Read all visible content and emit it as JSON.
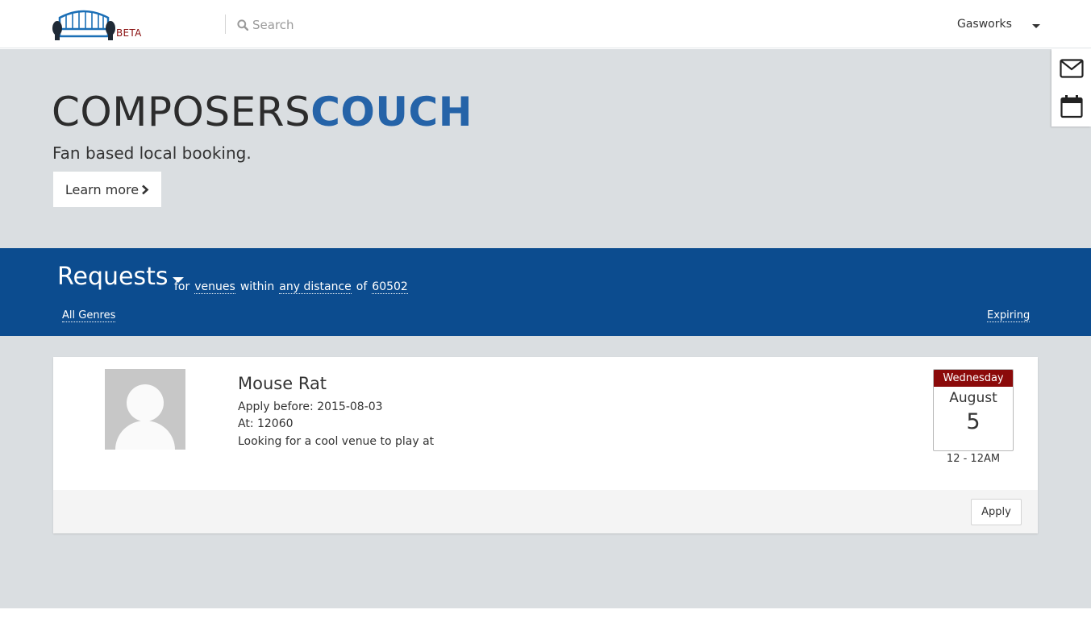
{
  "navbar": {
    "beta_label": "BETA",
    "search_placeholder": "Search",
    "search_icon": "search-icon",
    "user_name": "Gasworks",
    "colors": {
      "brand_blue": "#1b6fb6",
      "beta_red": "#8a1010"
    }
  },
  "hero": {
    "brand_part1": "COMPOSERS",
    "brand_part2": "COUCH",
    "tagline": "Fan based local booking.",
    "learn_more_label": "Learn more",
    "colors": {
      "background": "#dadee1",
      "brand_accent": "#2563a8"
    }
  },
  "side_panel": {
    "items": [
      {
        "icon": "envelope-icon"
      },
      {
        "icon": "calendar-icon"
      }
    ]
  },
  "requests": {
    "title": "Requests",
    "filter_for": "for",
    "filter_type": "venues",
    "filter_within": "within",
    "filter_distance": "any distance",
    "filter_of": "of",
    "filter_zip": "60502",
    "genres_label": "All Genres",
    "sort_label": "Expiring",
    "colors": {
      "band": "#0c4c8f"
    }
  },
  "listing": {
    "title": "Mouse Rat",
    "apply_before": "Apply before: 2015-08-03",
    "location": "At: 12060",
    "description": "Looking for a cool venue to play at",
    "date": {
      "day_of_week": "Wednesday",
      "month": "August",
      "day": "5"
    },
    "time": "12 - 12AM",
    "apply_label": "Apply",
    "colors": {
      "date_header": "#8b0a0a"
    }
  }
}
